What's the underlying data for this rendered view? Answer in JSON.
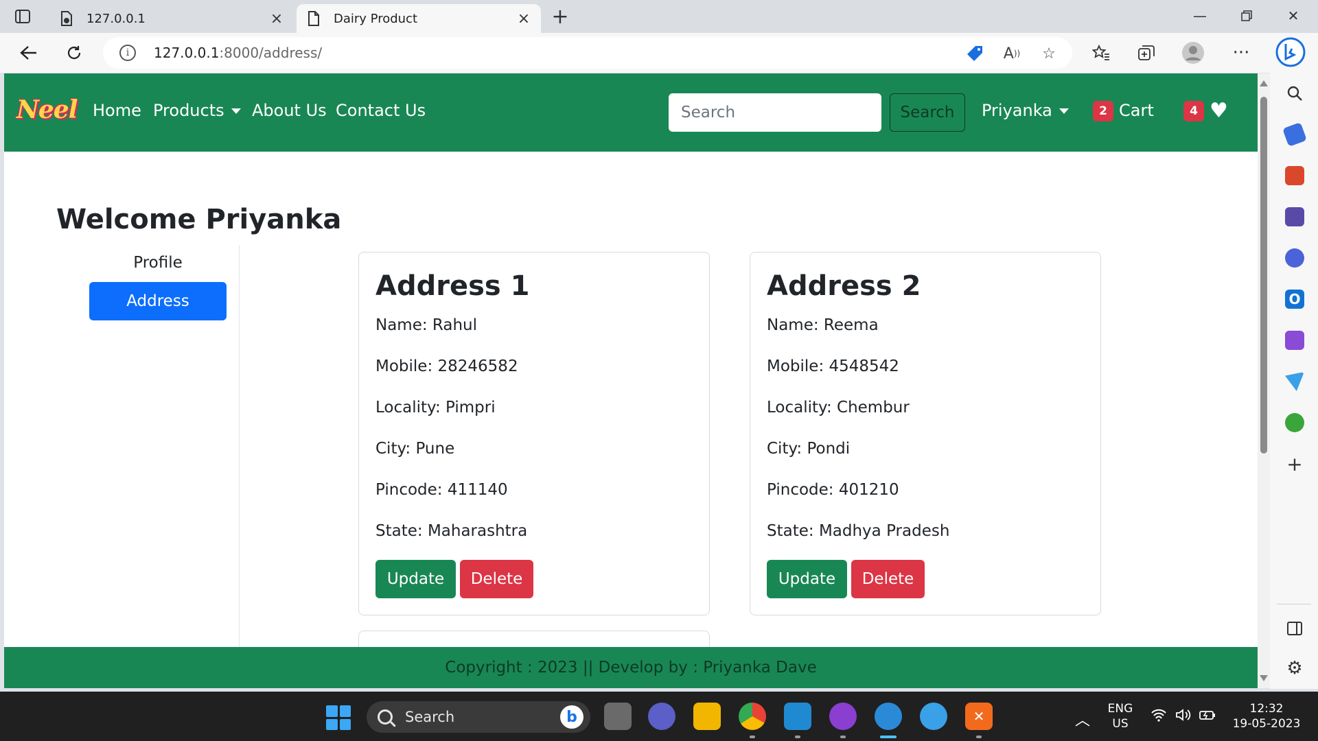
{
  "browser": {
    "tabs": [
      {
        "title": "127.0.0.1",
        "active": false
      },
      {
        "title": "Dairy Product",
        "active": true
      }
    ],
    "url_host": "127.0.0.1",
    "url_path": ":8000/address/"
  },
  "navbar": {
    "brand": "Neel",
    "links": {
      "home": "Home",
      "products": "Products",
      "about": "About Us",
      "contact": "Contact Us"
    },
    "search_placeholder": "Search",
    "search_button": "Search",
    "user": "Priyanka",
    "cart_label": "Cart",
    "cart_count": "2",
    "wishlist_count": "4"
  },
  "page": {
    "welcome": "Welcome Priyanka",
    "sidebar": {
      "profile": "Profile",
      "address": "Address"
    },
    "addresses": [
      {
        "title": "Address 1",
        "name": "Name: Rahul",
        "mobile": "Mobile: 28246582",
        "locality": "Locality: Pimpri",
        "city": "City: Pune",
        "pincode": "Pincode: 411140",
        "state": "State: Maharashtra",
        "update": "Update",
        "delete": "Delete"
      },
      {
        "title": "Address 2",
        "name": "Name: Reema",
        "mobile": "Mobile: 4548542",
        "locality": "Locality: Chembur",
        "city": "City: Pondi",
        "pincode": "Pincode: 401210",
        "state": "State: Madhya Pradesh",
        "update": "Update",
        "delete": "Delete"
      }
    ],
    "footer": "Copyright : 2023 || Develop by : Priyanka Dave"
  },
  "taskbar": {
    "search_placeholder": "Search",
    "language": "ENG",
    "region": "US",
    "time": "12:32",
    "date": "19-05-2023"
  },
  "colors": {
    "navbar": "#198754",
    "primary": "#0d6efd",
    "danger": "#dc3545",
    "success": "#198754"
  }
}
